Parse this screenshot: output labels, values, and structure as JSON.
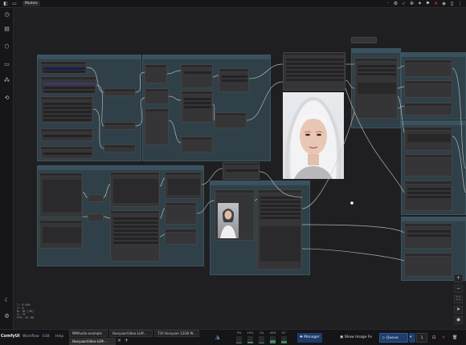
{
  "topbar": {
    "tab_label": "Models",
    "left_icons": [
      "comfy-logo-icon",
      "folder-icon"
    ],
    "right_icons": [
      "dot-icon",
      "settings-icon",
      "rocket-icon",
      "bug-icon",
      "sparkle-icon",
      "flag-icon",
      "close-icon",
      "diamond-icon",
      "sidebar-toggle-icon",
      "more-icon"
    ]
  },
  "sidebar": {
    "icons": [
      "queue-history-icon",
      "node-library-icon",
      "model-library-icon",
      "workflows-icon",
      "templates-icon",
      "sync-icon",
      "theme-toggle-icon",
      "settings-icon"
    ]
  },
  "stats": {
    "lines": [
      "T: 0.00s",
      "I: 0",
      "N: 38 [38]",
      "V: 79",
      "FPS: 61.00"
    ]
  },
  "canvas": {
    "status_dot_color": "#ffffff"
  },
  "bottombar": {
    "logo": "ComfyUI",
    "menu": [
      "Workflow",
      "Edit",
      "Help"
    ],
    "workflow_tabs": [
      {
        "label": "MMAudio-example",
        "active": false
      },
      {
        "label": "HunyuanVideo-LLM...",
        "active": false
      },
      {
        "label": "T2V Hunyuan 12GB W...",
        "active": false
      },
      {
        "label": "HunyuanVideo-LLM-...",
        "active": true
      }
    ],
    "meters": [
      {
        "label": "CPU",
        "value": "3%",
        "level": 0.03
      },
      {
        "label": "RAM",
        "value": "19%",
        "level": 0.19
      },
      {
        "label": "GPU",
        "value": "1%",
        "level": 0.01
      },
      {
        "label": "VRAM",
        "value": "45%",
        "level": 0.45
      },
      {
        "label": "Temp",
        "value": "31°",
        "level": 0.31
      }
    ],
    "manager_label": "Manager",
    "show_image_label": "Show Image Fe",
    "queue_label": "Queue",
    "batch_count": "1"
  }
}
